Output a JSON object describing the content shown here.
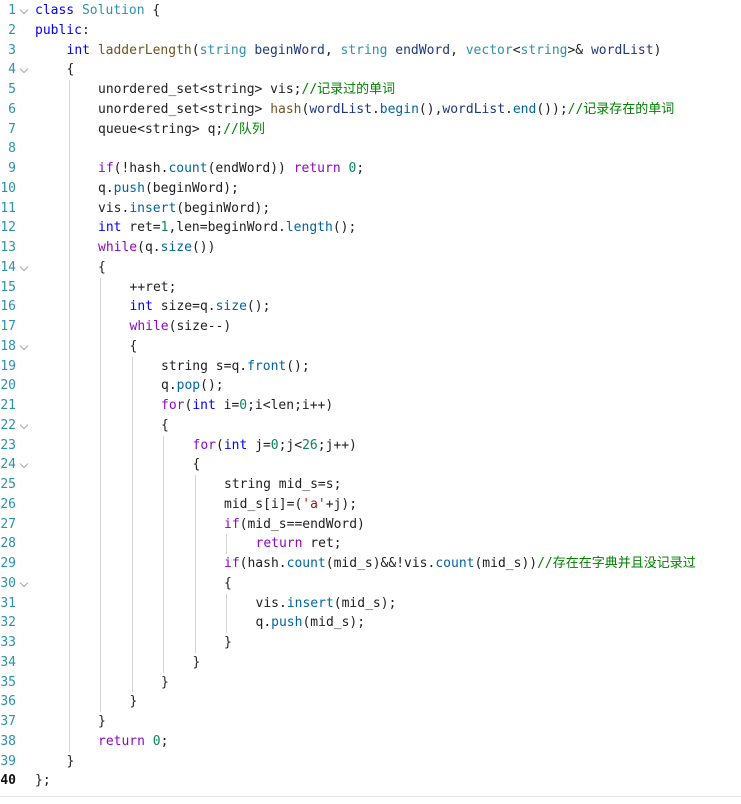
{
  "editor": {
    "current_line": 40,
    "lines": [
      {
        "n": "1",
        "fold": true,
        "indent": 0,
        "tokens": [
          [
            "class",
            "kw"
          ],
          [
            " ",
            ""
          ],
          [
            "Solution",
            "typ"
          ],
          [
            " {",
            ""
          ]
        ]
      },
      {
        "n": "2",
        "fold": false,
        "indent": 0,
        "tokens": [
          [
            "public",
            "kw"
          ],
          [
            ":",
            ""
          ]
        ]
      },
      {
        "n": "3",
        "fold": false,
        "indent": 1,
        "tokens": [
          [
            "int",
            "kw"
          ],
          [
            " ",
            ""
          ],
          [
            "ladderLength",
            "fn"
          ],
          [
            "(",
            ""
          ],
          [
            "string",
            "typ"
          ],
          [
            " ",
            ""
          ],
          [
            "beginWord",
            "prm"
          ],
          [
            ", ",
            ""
          ],
          [
            "string",
            "typ"
          ],
          [
            " ",
            ""
          ],
          [
            "endWord",
            "prm"
          ],
          [
            ", ",
            ""
          ],
          [
            "vector",
            "typ"
          ],
          [
            "<",
            ""
          ],
          [
            "string",
            "typ"
          ],
          [
            ">& ",
            ""
          ],
          [
            "wordList",
            "prm"
          ],
          [
            ")",
            ""
          ]
        ]
      },
      {
        "n": "4",
        "fold": true,
        "indent": 1,
        "tokens": [
          [
            "{",
            ""
          ]
        ]
      },
      {
        "n": "5",
        "fold": false,
        "indent": 2,
        "tokens": [
          [
            "unordered_set<string> vis;",
            ""
          ],
          [
            "//记录过的单词",
            "cmt"
          ]
        ]
      },
      {
        "n": "6",
        "fold": false,
        "indent": 2,
        "tokens": [
          [
            "unordered_set<string> ",
            ""
          ],
          [
            "hash",
            "fn"
          ],
          [
            "(",
            ""
          ],
          [
            "wordList",
            "prm"
          ],
          [
            ".",
            ""
          ],
          [
            "begin",
            "mem"
          ],
          [
            "(),",
            ""
          ],
          [
            "wordList",
            "prm"
          ],
          [
            ".",
            ""
          ],
          [
            "end",
            "mem"
          ],
          [
            "());",
            ""
          ],
          [
            "//记录存在的单词",
            "cmt"
          ]
        ]
      },
      {
        "n": "7",
        "fold": false,
        "indent": 2,
        "tokens": [
          [
            "queue<string> q;",
            ""
          ],
          [
            "//队列",
            "cmt"
          ]
        ]
      },
      {
        "n": "8",
        "fold": false,
        "indent": 2,
        "tokens": []
      },
      {
        "n": "9",
        "fold": false,
        "indent": 2,
        "tokens": [
          [
            "if",
            "ctl"
          ],
          [
            "(!hash.",
            ""
          ],
          [
            "count",
            "mem"
          ],
          [
            "(endWord)) ",
            ""
          ],
          [
            "return",
            "ctl"
          ],
          [
            " ",
            ""
          ],
          [
            "0",
            "num"
          ],
          [
            ";",
            ""
          ]
        ]
      },
      {
        "n": "10",
        "fold": false,
        "indent": 2,
        "tokens": [
          [
            "q.",
            ""
          ],
          [
            "push",
            "mem"
          ],
          [
            "(beginWord);",
            ""
          ]
        ]
      },
      {
        "n": "11",
        "fold": false,
        "indent": 2,
        "tokens": [
          [
            "vis.",
            ""
          ],
          [
            "insert",
            "mem"
          ],
          [
            "(beginWord);",
            ""
          ]
        ]
      },
      {
        "n": "12",
        "fold": false,
        "indent": 2,
        "tokens": [
          [
            "int",
            "kw"
          ],
          [
            " ret=",
            ""
          ],
          [
            "1",
            "num"
          ],
          [
            ",len=beginWord.",
            ""
          ],
          [
            "length",
            "mem"
          ],
          [
            "();",
            ""
          ]
        ]
      },
      {
        "n": "13",
        "fold": false,
        "indent": 2,
        "tokens": [
          [
            "while",
            "ctl"
          ],
          [
            "(q.",
            ""
          ],
          [
            "size",
            "mem"
          ],
          [
            "())",
            ""
          ]
        ]
      },
      {
        "n": "14",
        "fold": true,
        "indent": 2,
        "tokens": [
          [
            "{",
            ""
          ]
        ]
      },
      {
        "n": "15",
        "fold": false,
        "indent": 3,
        "tokens": [
          [
            "++ret;",
            ""
          ]
        ]
      },
      {
        "n": "16",
        "fold": false,
        "indent": 3,
        "tokens": [
          [
            "int",
            "kw"
          ],
          [
            " size=q.",
            ""
          ],
          [
            "size",
            "mem"
          ],
          [
            "();",
            ""
          ]
        ]
      },
      {
        "n": "17",
        "fold": false,
        "indent": 3,
        "tokens": [
          [
            "while",
            "ctl"
          ],
          [
            "(size--)",
            ""
          ]
        ]
      },
      {
        "n": "18",
        "fold": true,
        "indent": 3,
        "tokens": [
          [
            "{",
            ""
          ]
        ]
      },
      {
        "n": "19",
        "fold": false,
        "indent": 4,
        "tokens": [
          [
            "string s=q.",
            ""
          ],
          [
            "front",
            "mem"
          ],
          [
            "();",
            ""
          ]
        ]
      },
      {
        "n": "20",
        "fold": false,
        "indent": 4,
        "tokens": [
          [
            "q.",
            ""
          ],
          [
            "pop",
            "mem"
          ],
          [
            "();",
            ""
          ]
        ]
      },
      {
        "n": "21",
        "fold": false,
        "indent": 4,
        "tokens": [
          [
            "for",
            "ctl"
          ],
          [
            "(",
            ""
          ],
          [
            "int",
            "kw"
          ],
          [
            " i=",
            ""
          ],
          [
            "0",
            "num"
          ],
          [
            ";i<len;i++)",
            ""
          ]
        ]
      },
      {
        "n": "22",
        "fold": true,
        "indent": 4,
        "tokens": [
          [
            "{",
            ""
          ]
        ]
      },
      {
        "n": "23",
        "fold": false,
        "indent": 5,
        "tokens": [
          [
            "for",
            "ctl"
          ],
          [
            "(",
            ""
          ],
          [
            "int",
            "kw"
          ],
          [
            " j=",
            ""
          ],
          [
            "0",
            "num"
          ],
          [
            ";j<",
            ""
          ],
          [
            "26",
            "num"
          ],
          [
            ";j++)",
            ""
          ]
        ]
      },
      {
        "n": "24",
        "fold": true,
        "indent": 5,
        "tokens": [
          [
            "{",
            ""
          ]
        ]
      },
      {
        "n": "25",
        "fold": false,
        "indent": 6,
        "tokens": [
          [
            "string mid_s=s;",
            ""
          ]
        ]
      },
      {
        "n": "26",
        "fold": false,
        "indent": 6,
        "tokens": [
          [
            "mid_s[i]=(",
            ""
          ],
          [
            "'a'",
            "str"
          ],
          [
            "+j);",
            ""
          ]
        ]
      },
      {
        "n": "27",
        "fold": false,
        "indent": 6,
        "tokens": [
          [
            "if",
            "ctl"
          ],
          [
            "(mid_s==endWord)",
            ""
          ]
        ]
      },
      {
        "n": "28",
        "fold": false,
        "indent": 7,
        "tokens": [
          [
            "return",
            "ctl"
          ],
          [
            " ret;",
            ""
          ]
        ]
      },
      {
        "n": "29",
        "fold": false,
        "indent": 6,
        "tokens": [
          [
            "if",
            "ctl"
          ],
          [
            "(hash.",
            ""
          ],
          [
            "count",
            "mem"
          ],
          [
            "(mid_s)&&!vis.",
            ""
          ],
          [
            "count",
            "mem"
          ],
          [
            "(mid_s))",
            ""
          ],
          [
            "//存在在字典并且没记录过",
            "cmt"
          ]
        ]
      },
      {
        "n": "30",
        "fold": true,
        "indent": 6,
        "tokens": [
          [
            "{",
            ""
          ]
        ]
      },
      {
        "n": "31",
        "fold": false,
        "indent": 7,
        "tokens": [
          [
            "vis.",
            ""
          ],
          [
            "insert",
            "mem"
          ],
          [
            "(mid_s);",
            ""
          ]
        ]
      },
      {
        "n": "32",
        "fold": false,
        "indent": 7,
        "tokens": [
          [
            "q.",
            ""
          ],
          [
            "push",
            "mem"
          ],
          [
            "(mid_s);",
            ""
          ]
        ]
      },
      {
        "n": "33",
        "fold": false,
        "indent": 6,
        "tokens": [
          [
            "}",
            ""
          ]
        ]
      },
      {
        "n": "34",
        "fold": false,
        "indent": 5,
        "tokens": [
          [
            "}",
            ""
          ]
        ]
      },
      {
        "n": "35",
        "fold": false,
        "indent": 4,
        "tokens": [
          [
            "}",
            ""
          ]
        ]
      },
      {
        "n": "36",
        "fold": false,
        "indent": 3,
        "tokens": [
          [
            "}",
            ""
          ]
        ]
      },
      {
        "n": "37",
        "fold": false,
        "indent": 2,
        "tokens": [
          [
            "}",
            ""
          ]
        ]
      },
      {
        "n": "38",
        "fold": false,
        "indent": 2,
        "tokens": [
          [
            "return",
            "ctl"
          ],
          [
            " ",
            ""
          ],
          [
            "0",
            "num"
          ],
          [
            ";",
            ""
          ]
        ]
      },
      {
        "n": "39",
        "fold": false,
        "indent": 1,
        "tokens": [
          [
            "}",
            ""
          ]
        ]
      },
      {
        "n": "40",
        "fold": false,
        "indent": 0,
        "tokens": [
          [
            "};",
            ""
          ]
        ]
      }
    ]
  }
}
